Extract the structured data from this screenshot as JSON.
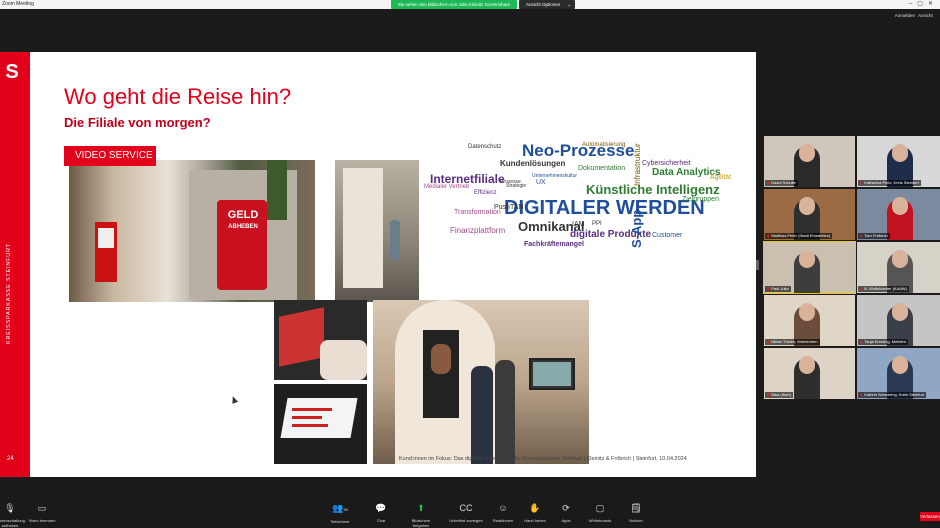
{
  "window": {
    "app_title": "Zoom Meeting"
  },
  "share_banner": {
    "text": "Sie sehen den Bildschirm von Julia Kleinitz Screenshare"
  },
  "view_options": {
    "label": "Ansicht Optionen"
  },
  "header": {
    "signin": "Anmelden",
    "view": "Ansicht"
  },
  "slide": {
    "title": "Wo geht die Reise hin?",
    "subtitle": "Die Filiale von morgen?",
    "badge": "VIDEO SERVICE",
    "logo": "S",
    "vertical_text": "KREISSPARKASSE STEINFURT",
    "page_number": "24",
    "footer": "Kund:innen im Fokus: Das digitale Ökosystem der Kreissparkasse Steinfurt | Kleinitz & Fröbrich | Steinfurt, 10.04.2024",
    "photo_texts": {
      "geld": "GELD",
      "abheben": "ABHEBEN"
    },
    "wordcloud": [
      {
        "t": "DIGITALER WERDEN",
        "c": "#1f4e9a"
      },
      {
        "t": "Neo-Prozesse",
        "c": "#1f4e9a"
      },
      {
        "t": "Künstliche Intelligenz",
        "c": "#2e7d32"
      },
      {
        "t": "Internetfiliale",
        "c": "#5a2d82"
      },
      {
        "t": "Omnikanal",
        "c": "#333333"
      },
      {
        "t": "digitale Produkte",
        "c": "#5a2d82"
      },
      {
        "t": "S-App",
        "c": "#1f4e9a"
      },
      {
        "t": "Data Analytics",
        "c": "#2e7d32"
      },
      {
        "t": "Kundenlösungen",
        "c": "#333333"
      },
      {
        "t": "Automatisierung",
        "c": "#7a5b00"
      },
      {
        "t": "Fachkräftemangel",
        "c": "#5a2d82"
      },
      {
        "t": "Finanzplattform",
        "c": "#a34a8a"
      },
      {
        "t": "Datenschutz",
        "c": "#333333"
      },
      {
        "t": "Dokumentation",
        "c": "#2e7d32"
      },
      {
        "t": "Infrastruktur",
        "c": "#7a5b00"
      },
      {
        "t": "Customer",
        "c": "#1f4e9a"
      },
      {
        "t": "Cybersicherheit",
        "c": "#5a2d82"
      },
      {
        "t": "Agilität",
        "c": "#c2a000"
      },
      {
        "t": "Transformation",
        "c": "#a34a8a"
      },
      {
        "t": "Medialer Vertrieb",
        "c": "#a34a8a"
      },
      {
        "t": "Effizienz",
        "c": "#5a2d82"
      },
      {
        "t": "UX",
        "c": "#1f4e9a"
      },
      {
        "t": "IAM",
        "c": "#333333"
      },
      {
        "t": "PPI",
        "c": "#333333"
      },
      {
        "t": "Unternehmenskultur",
        "c": "#1f4e9a"
      },
      {
        "t": "Zielgruppen",
        "c": "#2e7d32"
      },
      {
        "t": "PushTAN",
        "c": "#333333"
      },
      {
        "t": "Strategie",
        "c": "#333333"
      },
      {
        "t": "Prozesse",
        "c": "#333333"
      }
    ]
  },
  "participants": [
    {
      "name": "David Schulte",
      "bg": "#cfc7bb",
      "shirt": "#2a2a2a"
    },
    {
      "name": "Katharina Pietz, Kreis Steinfurt",
      "bg": "#d8d8d8",
      "shirt": "#1e2e4a"
    },
    {
      "name": "Matthias Peter (Stadt Emsdetten)",
      "bg": "#9a6b45",
      "shirt": "#2f2f2f"
    },
    {
      "name": "Tom Fröbrich",
      "bg": "#7c8aa0",
      "shirt": "#c1121f"
    },
    {
      "name": "Paul Julia",
      "bg": "#cbbfb0",
      "shirt": "#3d3d3d"
    },
    {
      "name": "B. Wulfekoetter (KAAW)",
      "bg": "#d7d2c8",
      "shirt": "#555555"
    },
    {
      "name": "Mieke Thelen, Ibbenbüren",
      "bg": "#e0d6c8",
      "shirt": "#6a4d3a"
    },
    {
      "name": "Tanja Ernsting, Metelen",
      "bg": "#c5c5c5",
      "shirt": "#3a3f4a"
    },
    {
      "name": "Nika (Ibert)",
      "bg": "#ddd3c6",
      "shirt": "#2e2e2e"
    },
    {
      "name": "Kathrin Schwering, Kreis Steinfurt",
      "bg": "#8fa6c4",
      "shirt": "#2b3a52"
    }
  ],
  "toolbar": {
    "unmute": "Stummschaltung aufheben",
    "video": "Video beenden",
    "participants": "Teilnehmer",
    "participants_count": "30",
    "chat": "Chat",
    "share": "Bildschirm freigeben",
    "captions": "Untertitel anzeigen",
    "reactions": "Reaktionen",
    "raise_hand": "Hand heben",
    "apps": "Apps",
    "whiteboards": "Whiteboards",
    "notes": "Notizen",
    "leave": "Verlassen"
  }
}
